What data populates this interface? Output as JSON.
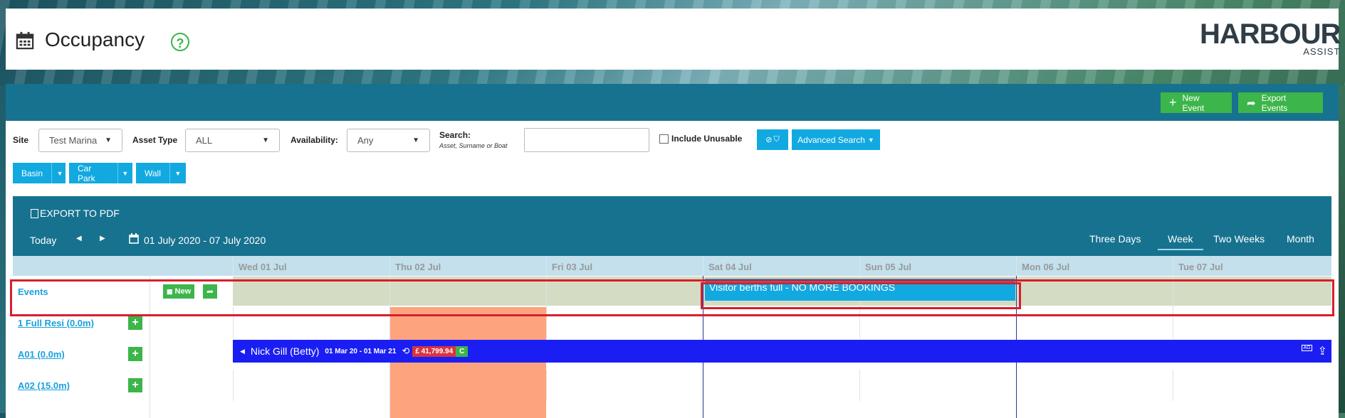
{
  "header": {
    "title": "Occupancy",
    "help": "?",
    "logo_main": "HARBOUR",
    "logo_sub": "ASSIST"
  },
  "toolbar": {
    "new_event": "New Event",
    "export_events": "Export Events"
  },
  "filters": {
    "site_label": "Site",
    "site_value": "Test Marina",
    "asset_type_label": "Asset Type",
    "asset_type_value": "ALL",
    "availability_label": "Availability:",
    "availability_value": "Any",
    "search_label": "Search:",
    "search_hint": "Asset, Surname or Boat",
    "search_value": "",
    "include_unusable": "Include Unusable",
    "advanced_search": "Advanced Search",
    "groups": [
      "Basin",
      "Car Park",
      "Wall"
    ]
  },
  "calendar": {
    "export_pdf": "EXPORT TO PDF",
    "today": "Today",
    "date_range": "01 July 2020 - 07 July 2020",
    "views": [
      "Three Days",
      "Week",
      "Two Weeks",
      "Month"
    ],
    "active_view": "Week",
    "days": [
      "Wed 01 Jul",
      "Thu 02 Jul",
      "Fri 03 Jul",
      "Sat 04 Jul",
      "Sun 05 Jul",
      "Mon 06 Jul",
      "Tue 07 Jul"
    ],
    "events_label": "Events",
    "events_new": "New",
    "event_banner": "Visitor berths full - NO MORE BOOKINGS",
    "rows": [
      {
        "name": "1 Full Resi (0.0m)"
      },
      {
        "name": "A01 (0.0m)"
      },
      {
        "name": "A02 (15.0m)"
      }
    ],
    "booking": {
      "customer": "Nick Gill (Betty)",
      "dates": "01 Mar 20 - 01 Mar 21",
      "amount": "£ 41,799.94",
      "status": "C",
      "tag": "AG"
    }
  }
}
